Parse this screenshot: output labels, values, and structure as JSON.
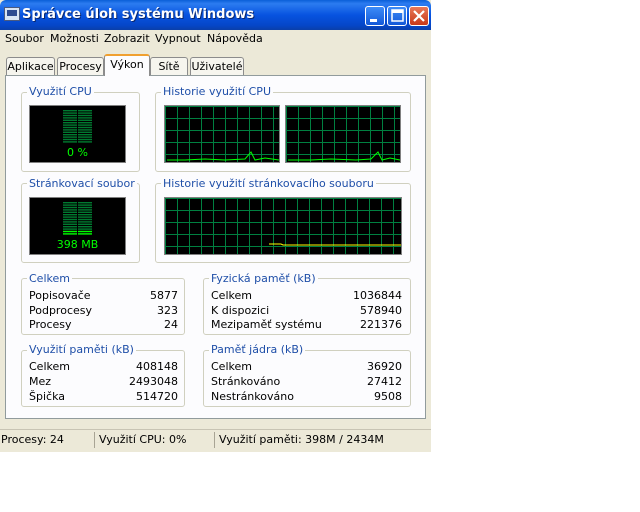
{
  "window": {
    "title": "Správce úloh systému Windows",
    "title_icon": "taskmgr-monitor-icon",
    "controls": [
      "minimize-icon",
      "maximize-icon",
      "close-icon"
    ]
  },
  "menu": [
    "Soubor",
    "Možnosti",
    "Zobrazit",
    "Vypnout",
    "Nápověda"
  ],
  "tabs": [
    "Aplikace",
    "Procesy",
    "Výkon",
    "Sítě",
    "Uživatelé"
  ],
  "active_tab": "Výkon",
  "cpu_usage": {
    "label": "Využití CPU",
    "value": "0 %",
    "level_percent": 0
  },
  "cpu_history": {
    "label": "Historie využití CPU"
  },
  "pagefile": {
    "label": "Stránkovací soubor",
    "value": "398 MB",
    "level_fraction": 0.16
  },
  "pagefile_history": {
    "label": "Historie využití stránkovacího souboru"
  },
  "totals": {
    "label": "Celkem",
    "rows": [
      {
        "name": "Popisovače",
        "value": "5877"
      },
      {
        "name": "Podprocesy",
        "value": "323"
      },
      {
        "name": "Procesy",
        "value": "24"
      }
    ]
  },
  "physical_memory": {
    "label": "Fyzická paměť (kB)",
    "rows": [
      {
        "name": "Celkem",
        "value": "1036844"
      },
      {
        "name": "K dispozici",
        "value": "578940"
      },
      {
        "name": "Mezipaměť systému",
        "value": "221376"
      }
    ]
  },
  "commit_charge": {
    "label": "Využití paměti (kB)",
    "rows": [
      {
        "name": "Celkem",
        "value": "408148"
      },
      {
        "name": "Mez",
        "value": "2493048"
      },
      {
        "name": "Špička",
        "value": "514720"
      }
    ]
  },
  "kernel_memory": {
    "label": "Paměť jádra (kB)",
    "rows": [
      {
        "name": "Celkem",
        "value": "36920"
      },
      {
        "name": "Stránkováno",
        "value": "27412"
      },
      {
        "name": "Nestránkováno",
        "value": "9508"
      }
    ]
  },
  "statusbar": {
    "processes": "Procesy: 24",
    "cpu": "Využití CPU: 0%",
    "memory": "Využití paměti: 398M / 2434M"
  },
  "colors": {
    "graph_grid": "#008040",
    "graph_line": "#00ff00",
    "pagefile_line": "#ffff00",
    "group_label": "#1f4fa8",
    "titlebar": "#0753e0"
  }
}
